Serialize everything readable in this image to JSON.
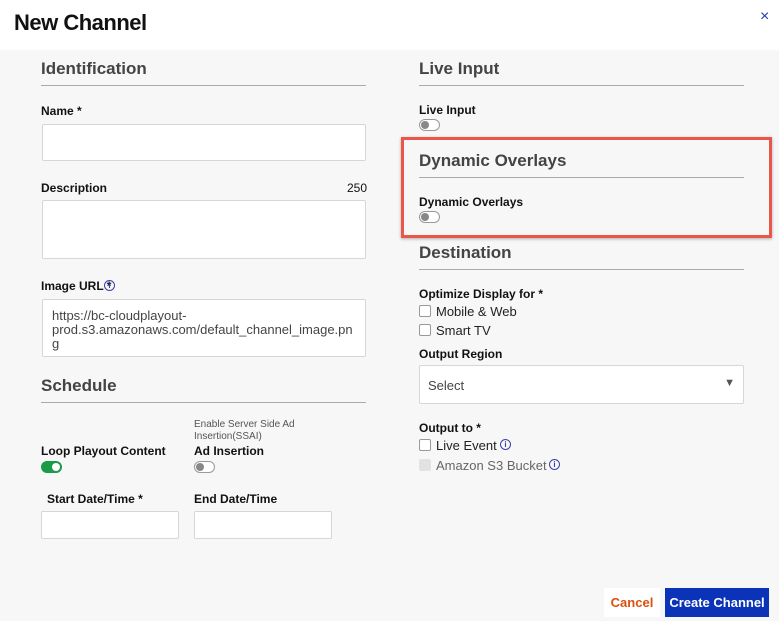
{
  "title": "New Channel",
  "close_icon": "×",
  "identification": {
    "heading": "Identification",
    "name_label": "Name *",
    "name_value": "",
    "description_label": "Description",
    "description_count": "250",
    "description_value": "",
    "image_url_label": "Image URL *",
    "image_url_value": "https://bc-cloudplayout-prod.s3.amazonaws.com/default_channel_image.png"
  },
  "schedule": {
    "heading": "Schedule",
    "loop_label": "Loop Playout Content",
    "loop_on": true,
    "ssai_hint": "Enable Server Side Ad Insertion(SSAI)",
    "ad_label": "Ad Insertion",
    "ad_on": false,
    "start_label": "Start Date/Time *",
    "end_label": "End Date/Time"
  },
  "live_input": {
    "heading": "Live Input",
    "label": "Live Input",
    "on": false
  },
  "dynamic_overlays": {
    "heading": "Dynamic Overlays",
    "label": "Dynamic Overlays",
    "on": false,
    "highlight_color": "#e8574a"
  },
  "destination": {
    "heading": "Destination",
    "optimize_label": "Optimize Display for *",
    "options": [
      "Mobile & Web",
      "Smart TV"
    ],
    "region_label": "Output Region",
    "region_value": "Select",
    "output_label": "Output to *",
    "outputs": [
      "Live Event",
      "Amazon S3 Bucket"
    ]
  },
  "footer": {
    "cancel": "Cancel",
    "create": "Create Channel"
  }
}
